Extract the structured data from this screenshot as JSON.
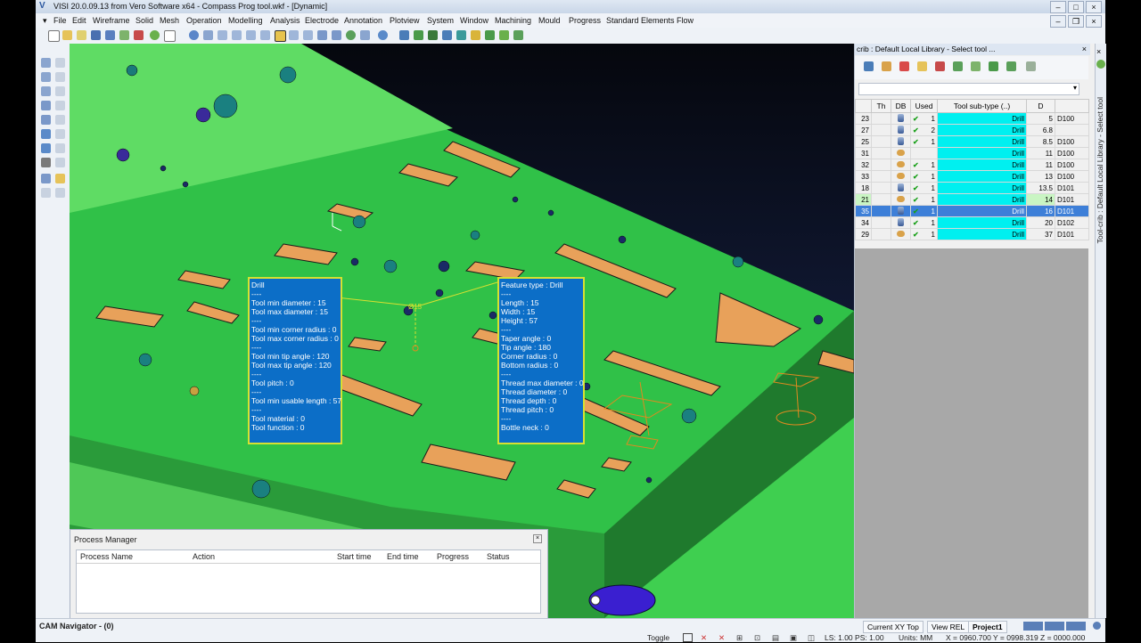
{
  "window": {
    "title": "VISI 20.0.09.13 from Vero Software x64 - Compass Prog tool.wkf - [Dynamic]",
    "logo": "V"
  },
  "menu": [
    "File",
    "Edit",
    "Wireframe",
    "Solid",
    "Mesh",
    "Operation",
    "Modelling",
    "Analysis",
    "Electrode",
    "Annotation",
    "Plotview",
    "System",
    "Window",
    "Machining",
    "Mould",
    "Progress",
    "Standard Elements",
    "Flow"
  ],
  "popup_left": {
    "lines": [
      "Drill",
      "----",
      "Tool min diameter : 15",
      "Tool max diameter : 15",
      "----",
      "Tool min corner radius : 0",
      "Tool max corner radius : 0",
      "----",
      "Tool min tip angle : 120",
      "Tool max tip angle : 120",
      "----",
      "Tool pitch : 0",
      "----",
      "Tool min usable length : 57",
      "----",
      "Tool material : 0",
      "Tool function : 0"
    ]
  },
  "popup_right": {
    "lines": [
      "Feature type : Drill",
      "----",
      "Length : 15",
      "Width : 15",
      "Height : 57",
      "----",
      "Taper angle : 0",
      "Tip angle : 180",
      "Corner radius : 0",
      "Bottom radius : 0",
      "----",
      "Thread max diameter : 0",
      "Thread diameter : 0",
      "Thread depth : 0",
      "Thread pitch : 0",
      "----",
      "Bottle neck : 0"
    ]
  },
  "tool_panel": {
    "title": "crib : Default Local Library - Select tool ...",
    "close": "×",
    "columns": [
      "",
      "Th",
      "DB",
      "Used",
      "Tool sub-type (..)",
      "D",
      ""
    ],
    "rows": [
      {
        "num": "23",
        "db": "db",
        "used": "1",
        "check": true,
        "sub": "Drill",
        "d": "5",
        "code": "D100"
      },
      {
        "num": "27",
        "db": "db",
        "used": "2",
        "check": true,
        "sub": "Drill",
        "d": "6.8",
        "code": ""
      },
      {
        "num": "25",
        "db": "db",
        "used": "1",
        "check": true,
        "sub": "Drill",
        "d": "8.5",
        "code": "D100"
      },
      {
        "num": "31",
        "db": "hand",
        "used": "",
        "check": false,
        "sub": "Drill",
        "d": "11",
        "code": "D100"
      },
      {
        "num": "32",
        "db": "hand",
        "used": "1",
        "check": true,
        "sub": "Drill",
        "d": "11",
        "code": "D100"
      },
      {
        "num": "33",
        "db": "hand",
        "used": "1",
        "check": true,
        "sub": "Drill",
        "d": "13",
        "code": "D100"
      },
      {
        "num": "18",
        "db": "db",
        "used": "1",
        "check": true,
        "sub": "Drill",
        "d": "13.5",
        "code": "D101"
      },
      {
        "num": "21",
        "db": "hand",
        "used": "1",
        "check": true,
        "sub": "Drill",
        "d": "14",
        "code": "D101",
        "hl": true
      },
      {
        "num": "35",
        "db": "db",
        "used": "1",
        "check": true,
        "sub": "Drill",
        "d": "16",
        "code": "D101",
        "sel": true
      },
      {
        "num": "34",
        "db": "db",
        "used": "1",
        "check": true,
        "sub": "Drill",
        "d": "20",
        "code": "D102"
      },
      {
        "num": "29",
        "db": "hand",
        "used": "1",
        "check": true,
        "sub": "Drill",
        "d": "37",
        "code": "D101"
      }
    ]
  },
  "side_tab": "Tool-crib : Default Local Library - Select tool",
  "process_manager": {
    "title": "Process Manager",
    "columns": [
      "Process Name",
      "Action",
      "Start time",
      "End time",
      "Progress",
      "Status"
    ]
  },
  "status": {
    "cam_navigator": "CAM Navigator - (0)",
    "view_top": "Current XY Top",
    "view_rel": "View REL",
    "project": "Project1",
    "toggle": "Toggle",
    "ls_ps": "LS: 1.00 PS: 1.00",
    "units": "Units: MM",
    "coords": "X = 0960.700 Y = 0998.319 Z = 0000.000"
  },
  "colors": {
    "plate_green": "#2fc04a",
    "slot_orange": "#e8a15a",
    "popup_blue": "#0c6ec7",
    "selection": "#3d7fd8",
    "cyan": "#00f0f0"
  }
}
